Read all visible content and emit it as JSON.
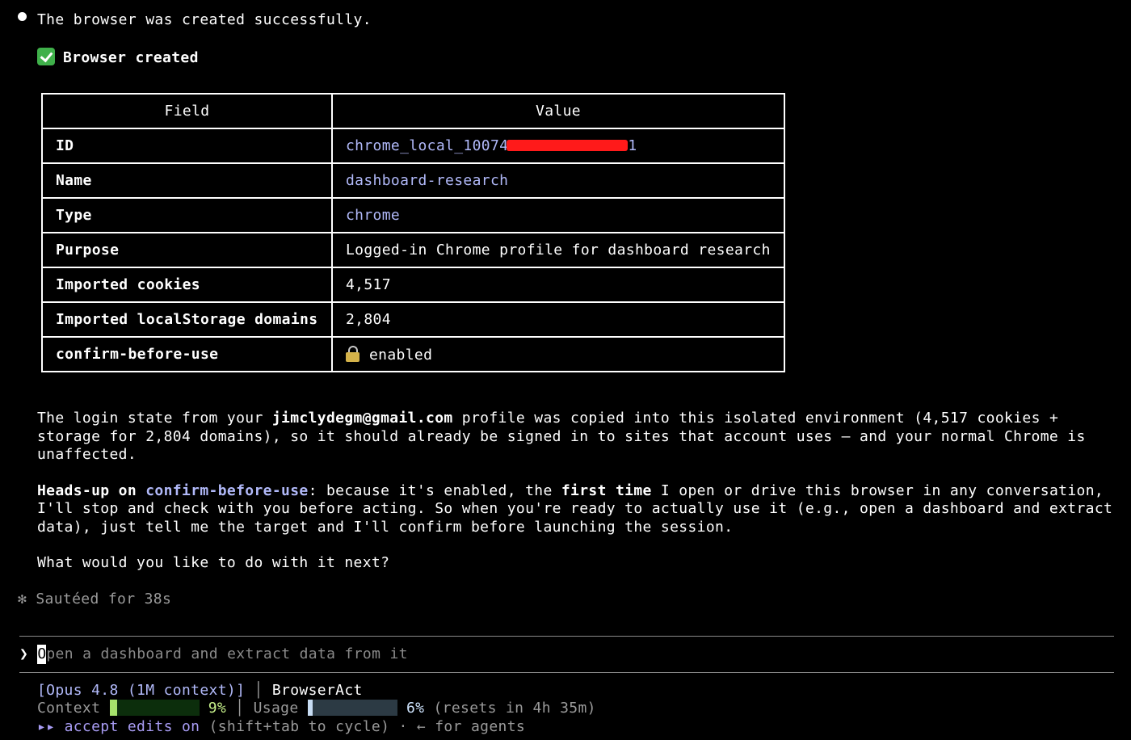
{
  "messages": {
    "status": "The browser was created successfully.",
    "created_heading": "Browser created"
  },
  "table": {
    "headers": [
      "Field",
      "Value"
    ],
    "rows": [
      {
        "field": "ID",
        "value": "chrome_local_10074",
        "value_tail": "1"
      },
      {
        "field": "Name",
        "value": "dashboard-research"
      },
      {
        "field": "Type",
        "value": "chrome"
      },
      {
        "field": "Purpose",
        "value": "Logged-in Chrome profile for dashboard research"
      },
      {
        "field": "Imported cookies",
        "value": "4,517"
      },
      {
        "field": "Imported localStorage domains",
        "value": "2,804"
      },
      {
        "field": "confirm-before-use",
        "value": "enabled"
      }
    ]
  },
  "paragraph1": {
    "p1a": "The login state from your ",
    "email": "jimclydegm@gmail.com",
    "p1b": " profile was copied into this isolated environment (4,517 cookies +",
    "l2": "storage for 2,804 domains), so it should already be signed in to sites that account uses — and your normal Chrome is",
    "l3": "unaffected."
  },
  "paragraph2": {
    "heads_up": "Heads-up on ",
    "flag": "confirm-before-use",
    "p2a": ": because it's enabled, the ",
    "first_time": "first time",
    "p2b": " I open or drive this browser in any conversation,",
    "l2": "I'll stop and check with you before acting. So when you're ready to actually use it (e.g., open a dashboard and extract",
    "l3": "data), just tell me the target and I'll confirm before launching the session."
  },
  "question": "What would you like to do with it next?",
  "timing": {
    "star": "✻",
    "text": "Sautéed for 38s"
  },
  "input": {
    "prompt_symbol": "❯",
    "cursor_char": "O",
    "placeholder_rest": "pen a dashboard and extract data from it"
  },
  "status_bar": {
    "model": "[Opus 4.8 (1M context)]",
    "separator": "│",
    "app": "BrowserAct",
    "context_label": "Context",
    "context_pct": "9%",
    "context_fraction": 0.09,
    "usage_label": "Usage",
    "usage_pct": "6%",
    "usage_fraction": 0.06,
    "resets": "(resets in 4h 35m)",
    "mode_arrows": "▸▸",
    "mode_label": "accept edits on",
    "mode_hint": "(shift+tab to cycle) · ← for agents"
  },
  "colors": {
    "accent": "#b1b9f9",
    "check_green": "#3fb04a",
    "redaction": "#ff1a1a",
    "context_fill": "#a6e36b",
    "usage_fill": "#c7dcf3"
  }
}
